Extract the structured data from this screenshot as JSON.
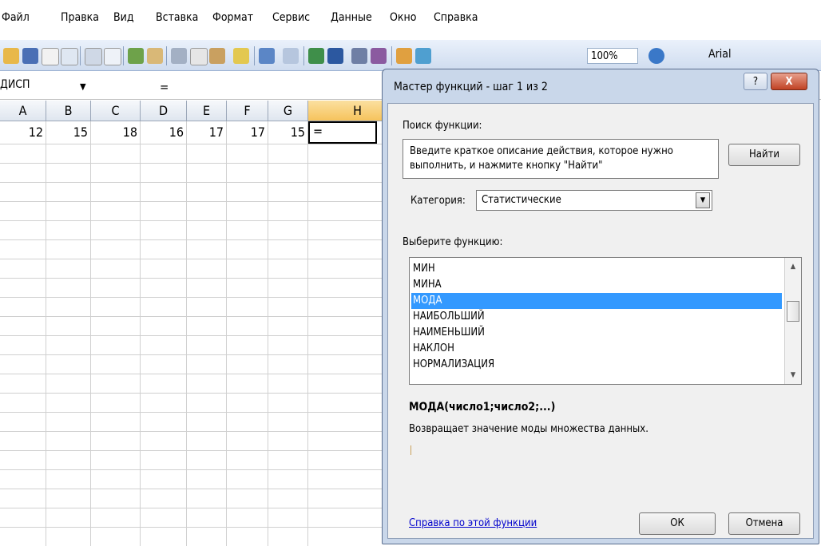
{
  "menu": [
    {
      "label": "Файл"
    },
    {
      "label": "Правка"
    },
    {
      "label": "Вид"
    },
    {
      "label": "Вставка"
    },
    {
      "label": "Формат"
    },
    {
      "label": "Сервис"
    },
    {
      "label": "Данные"
    },
    {
      "label": "Окно"
    },
    {
      "label": "Справка"
    }
  ],
  "toolbar": {
    "zoom": "100%",
    "font": "Arial"
  },
  "formula_bar": {
    "name_box": "ДИСП",
    "content": "="
  },
  "sheet": {
    "columns": [
      "A",
      "B",
      "C",
      "D",
      "E",
      "F",
      "G",
      "H"
    ],
    "row1": [
      "12",
      "15",
      "18",
      "16",
      "17",
      "17",
      "15"
    ],
    "active_cell_content": "="
  },
  "dialog": {
    "title": "Мастер функций - шаг 1 из 2",
    "help_button": "?",
    "close_button": "X",
    "search_label": "Поиск функции:",
    "search_text": "Введите краткое описание действия, которое нужно выполнить, и нажмите кнопку \"Найти\"",
    "find_button": "Найти",
    "category_label": "Категория:",
    "category_value": "Статистические",
    "select_label": "Выберите функцию:",
    "functions": [
      "МИН",
      "МИНА",
      "МОДА",
      "НАИБОЛЬШИЙ",
      "НАИМЕНЬШИЙ",
      "НАКЛОН",
      "НОРМАЛИЗАЦИЯ"
    ],
    "selected_function": "МОДА",
    "signature": "МОДА(число1;число2;...)",
    "description": "Возвращает значение моды множества данных.",
    "help_link": "Справка по этой функции",
    "ok_button": "ОК",
    "cancel_button": "Отмена"
  }
}
